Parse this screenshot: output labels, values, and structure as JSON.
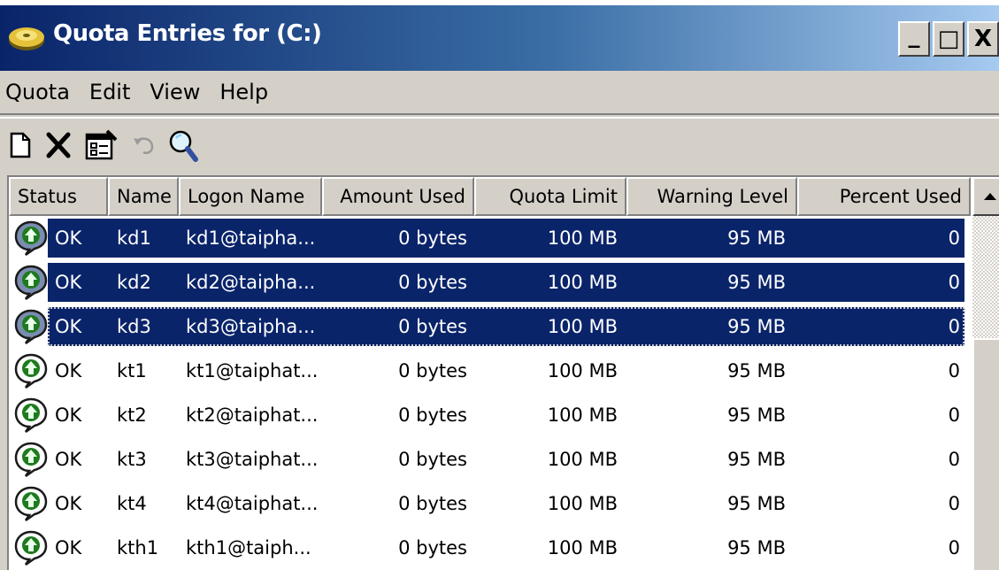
{
  "window": {
    "title": "Quota Entries for  (C:)",
    "controls": {
      "minimize": "_",
      "maximize": "□",
      "close": "X"
    }
  },
  "menu": [
    "Quota",
    "Edit",
    "View",
    "Help"
  ],
  "toolbar": [
    "new-entry-icon",
    "delete-icon",
    "properties-icon",
    "undo-icon",
    "find-icon"
  ],
  "columns": [
    "Status",
    "Name",
    "Logon Name",
    "Amount Used",
    "Quota Limit",
    "Warning Level",
    "Percent Used"
  ],
  "rows": [
    {
      "status": "OK",
      "name": "kd1",
      "logon": "kd1@taipha...",
      "used": "0 bytes",
      "limit": "100 MB",
      "warning": "95 MB",
      "percent": "0",
      "selected": true
    },
    {
      "status": "OK",
      "name": "kd2",
      "logon": "kd2@taipha...",
      "used": "0 bytes",
      "limit": "100 MB",
      "warning": "95 MB",
      "percent": "0",
      "selected": true
    },
    {
      "status": "OK",
      "name": "kd3",
      "logon": "kd3@taipha...",
      "used": "0 bytes",
      "limit": "100 MB",
      "warning": "95 MB",
      "percent": "0",
      "selected": true,
      "focused": true
    },
    {
      "status": "OK",
      "name": "kt1",
      "logon": "kt1@taiphat...",
      "used": "0 bytes",
      "limit": "100 MB",
      "warning": "95 MB",
      "percent": "0"
    },
    {
      "status": "OK",
      "name": "kt2",
      "logon": "kt2@taiphat...",
      "used": "0 bytes",
      "limit": "100 MB",
      "warning": "95 MB",
      "percent": "0"
    },
    {
      "status": "OK",
      "name": "kt3",
      "logon": "kt3@taiphat...",
      "used": "0 bytes",
      "limit": "100 MB",
      "warning": "95 MB",
      "percent": "0"
    },
    {
      "status": "OK",
      "name": "kt4",
      "logon": "kt4@taiphat...",
      "used": "0 bytes",
      "limit": "100 MB",
      "warning": "95 MB",
      "percent": "0"
    },
    {
      "status": "OK",
      "name": "kth1",
      "logon": "kth1@taiph...",
      "used": "0 bytes",
      "limit": "100 MB",
      "warning": "95 MB",
      "percent": "0"
    }
  ],
  "colors": {
    "titlebar_start": "#0a246a",
    "titlebar_end": "#a6caf0",
    "selection": "#0a246a",
    "chrome": "#d4d0c8"
  }
}
